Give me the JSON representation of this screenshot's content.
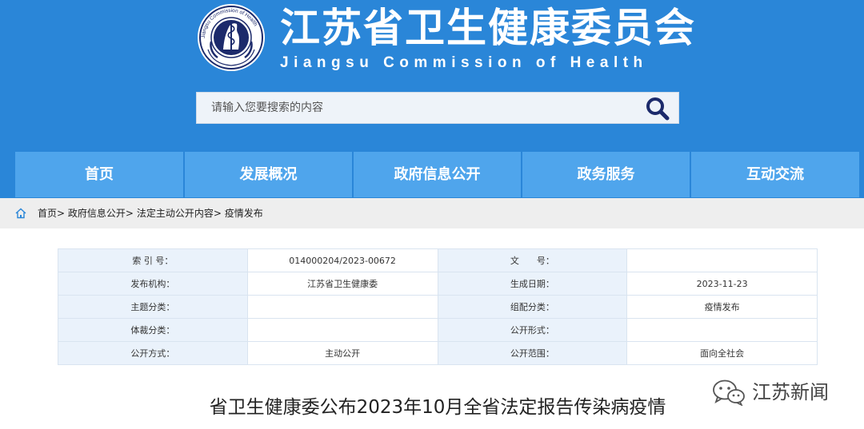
{
  "header": {
    "title": "江苏省卫生健康委员会",
    "subtitle": "Jiangsu Commission of Health",
    "logo_text": "Jiangsu Commission of Health",
    "colors": {
      "header_bg": "#2a86d8",
      "nav_item_bg": "#4fa5ec",
      "icon_dark": "#1c2a6b"
    }
  },
  "search": {
    "placeholder": "请输入您要搜索的内容",
    "icon": "search-icon"
  },
  "nav": {
    "items": [
      {
        "label": "首页"
      },
      {
        "label": "发展概况"
      },
      {
        "label": "政府信息公开"
      },
      {
        "label": "政务服务"
      },
      {
        "label": "互动交流"
      }
    ]
  },
  "breadcrumb": {
    "icon": "home-icon",
    "items": [
      "首页",
      "政府信息公开",
      "法定主动公开内容",
      "疫情发布"
    ],
    "separator": ">"
  },
  "meta": {
    "rows": [
      {
        "k1": "索 引 号：",
        "v1": "014000204/2023-00672",
        "k2": "文　　号：",
        "v2": ""
      },
      {
        "k1": "发布机构：",
        "v1": "江苏省卫生健康委",
        "k2": "生成日期：",
        "v2": "2023-11-23"
      },
      {
        "k1": "主题分类：",
        "v1": "",
        "k2": "组配分类：",
        "v2": "疫情发布"
      },
      {
        "k1": "体裁分类：",
        "v1": "",
        "k2": "公开形式：",
        "v2": ""
      },
      {
        "k1": "公开方式：",
        "v1": "主动公开",
        "k2": "公开范围：",
        "v2": "面向全社会"
      }
    ]
  },
  "article": {
    "title": "省卫生健康委公布2023年10月全省法定报告传染病疫情"
  },
  "watermark": {
    "icon": "wechat-icon",
    "text": "江苏新闻"
  }
}
